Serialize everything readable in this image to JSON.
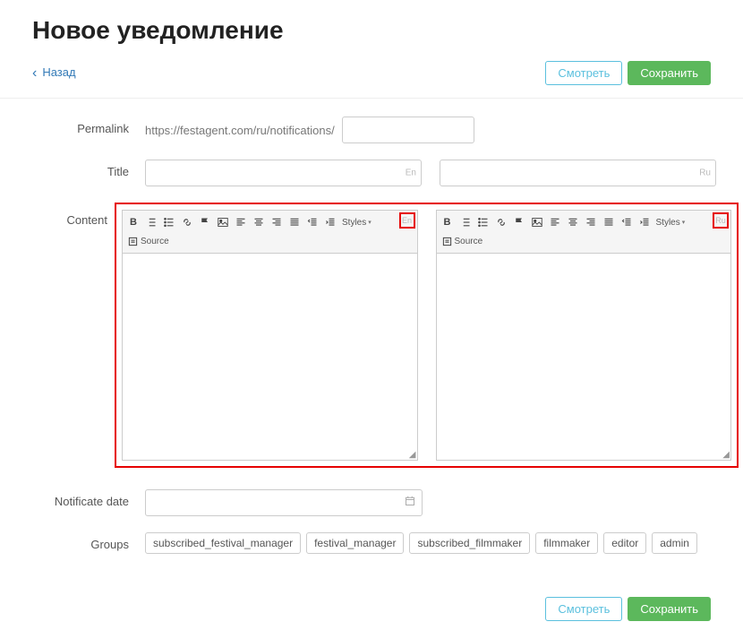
{
  "page_title": "Новое уведомление",
  "back_label": "Назад",
  "buttons": {
    "preview": "Смотреть",
    "save": "Сохранить"
  },
  "form": {
    "permalink_label": "Permalink",
    "permalink_prefix": "https://festagent.com/ru/notifications/",
    "permalink_value": "",
    "title_label": "Title",
    "title_en_value": "",
    "title_ru_value": "",
    "lang_en": "En",
    "lang_ru": "Ru",
    "content_label": "Content",
    "editor": {
      "styles_label": "Styles",
      "source_label": "Source"
    },
    "date_label": "Notificate date",
    "date_value": "",
    "groups_label": "Groups",
    "groups": [
      "subscribed_festival_manager",
      "festival_manager",
      "subscribed_filmmaker",
      "filmmaker",
      "editor",
      "admin"
    ]
  }
}
